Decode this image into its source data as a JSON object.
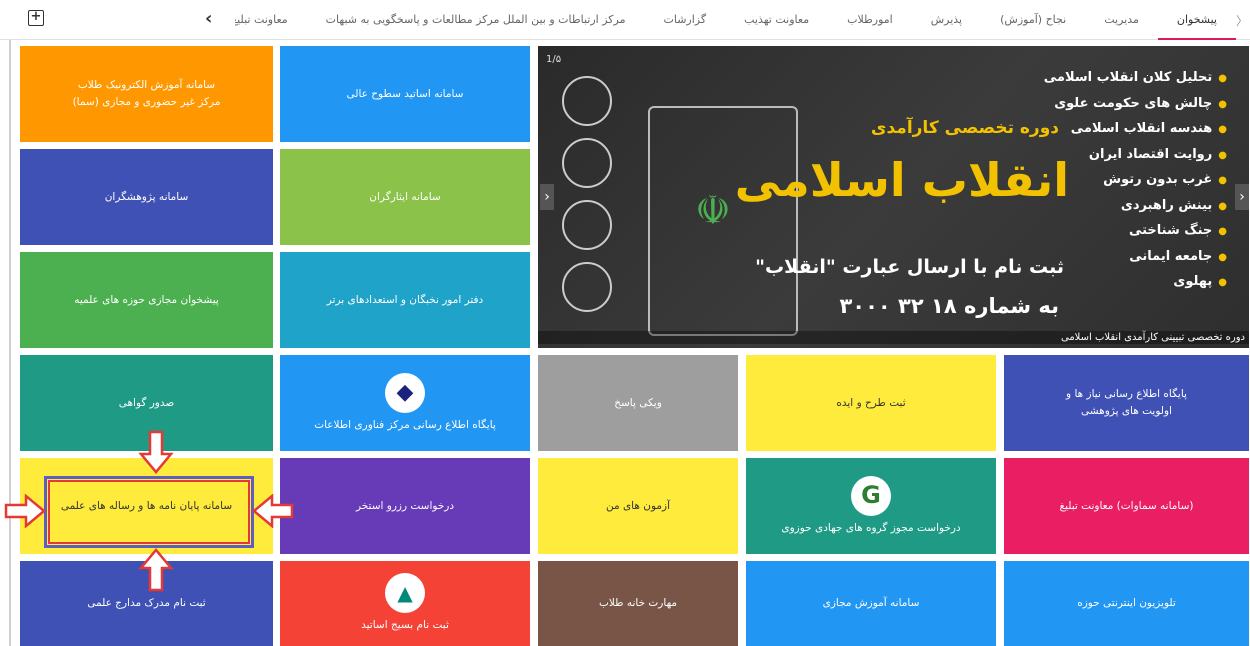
{
  "topbar": {
    "tabs": [
      {
        "label": "پیشخوان",
        "active": true
      },
      {
        "label": "مدیریت"
      },
      {
        "label": "نجاح (آموزش)"
      },
      {
        "label": "پذیرش"
      },
      {
        "label": "امورطلاب"
      },
      {
        "label": "معاونت تهذیب"
      },
      {
        "label": "گزارشات"
      },
      {
        "label": "مرکز ارتباطات و بین الملل مرکز مطالعات و پاسخگویی به شبهات"
      },
      {
        "label": "معاونت تبلیغ"
      }
    ],
    "edge_glyph": "〈"
  },
  "slider": {
    "counter": "1/۵",
    "topics": [
      "تحلیل کلان انقلاب اسلامی",
      "چالش های حکومت علوی",
      "هندسه انقلاب اسلامی",
      "روایت اقتصاد ایران",
      "غرب بدون رتوش",
      "بینش راهبردی",
      "جنگ شناختی",
      "جامعه ایمانی",
      "پهلوی"
    ],
    "subtitle": "دوره تخصصی کارآمدی",
    "main_title": "انقلاب اسلامی",
    "register_text": "ثبت نام با ارسال عبارت \"انقلاب\"",
    "number_text": "به شماره ۱۸ ۳۲ ۳۰۰۰",
    "caption": "دوره تخصصی تبیینی کارآمدی انقلاب اسلامی"
  },
  "tiles": {
    "sama": "سامانه آموزش الکترونیک طلاب\nمرکز غیر حضوری و مجازی (سما)",
    "asatid": "سامانه اساتید سطوح عالی",
    "pajouheshgaran": "سامانه پژوهشگران",
    "isargaran": "سامانه ایثارگران",
    "pishkhan_majazi": "پیشخوان مجازی حوزه های علمیه",
    "nokhbegan": "دفتر امور نخبگان و استعدادهای برتر",
    "pajgah_niaz": "پایگاه اطلاع رسانی نیاز ها و\nاولویت های پژوهشی",
    "sabt_tarh": "ثبت طرح و ایده",
    "wiki": "ویکی پاسخ",
    "fanavari": "پایگاه اطلاع رسانی مرکز فناوری اطلاعات",
    "govahi": "صدور گواهی",
    "samavat": "(سامانه سماوات) معاونت تبلیغ",
    "jahadi": "درخواست مجوز گروه های جهادی حوزوی",
    "azmoon": "آزمون های من",
    "estakhr": "درخواست رزرو استخر",
    "payan_nameh": "سامانه پایان نامه ها و رساله های علمی",
    "television": "تلویزیون اینترنتی حوزه",
    "amoozesh_majazi": "سامانه آموزش مجازی",
    "maharat": "مهارت خانه طلاب",
    "basij": "ثبت نام بسیج اساتید",
    "madrak": "ثبت نام مدرک مدارج علمی"
  },
  "colors": {
    "orange": "#ff9800",
    "blue": "#2196f3",
    "indigo": "#3f51b5",
    "light_green": "#8bc34a",
    "green": "#4caf50",
    "teal": "#1e9a85",
    "grey": "#9e9e9e",
    "yellow": "#ffeb3b",
    "pink": "#e91e63",
    "deep_purple": "#673ab7",
    "red": "#f44336",
    "brown": "#795548",
    "highlight_red": "#e53935"
  }
}
